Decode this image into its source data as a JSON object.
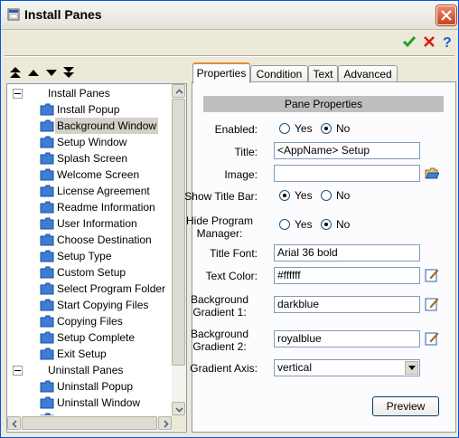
{
  "window": {
    "title": "Install Panes"
  },
  "toolbar": {
    "ok_icon": "check-icon",
    "cancel_icon": "x-icon",
    "help_icon": "question-icon"
  },
  "tree": {
    "items": [
      {
        "label": "Install Panes",
        "type": "group"
      },
      {
        "label": "Install Popup",
        "type": "folder"
      },
      {
        "label": "Background Window",
        "type": "folder",
        "selected": true
      },
      {
        "label": "Setup Window",
        "type": "folder"
      },
      {
        "label": "Splash Screen",
        "type": "folder"
      },
      {
        "label": "Welcome Screen",
        "type": "folder"
      },
      {
        "label": "License Agreement",
        "type": "folder"
      },
      {
        "label": "Readme Information",
        "type": "folder"
      },
      {
        "label": "User Information",
        "type": "folder"
      },
      {
        "label": "Choose Destination",
        "type": "folder"
      },
      {
        "label": "Setup Type",
        "type": "folder"
      },
      {
        "label": "Custom Setup",
        "type": "folder"
      },
      {
        "label": "Select Program Folder",
        "type": "folder"
      },
      {
        "label": "Start Copying Files",
        "type": "folder"
      },
      {
        "label": "Copying Files",
        "type": "folder"
      },
      {
        "label": "Setup Complete",
        "type": "folder"
      },
      {
        "label": "Exit Setup",
        "type": "folder"
      },
      {
        "label": "Uninstall Panes",
        "type": "group"
      },
      {
        "label": "Uninstall Popup",
        "type": "folder"
      },
      {
        "label": "Uninstall Window",
        "type": "folder"
      }
    ]
  },
  "tabs": [
    {
      "label": "Properties",
      "active": true
    },
    {
      "label": "Condition"
    },
    {
      "label": "Text"
    },
    {
      "label": "Advanced"
    }
  ],
  "panel": {
    "header": "Pane Properties",
    "enabled": {
      "label": "Enabled:",
      "yes": "Yes",
      "no": "No",
      "value": "No"
    },
    "title": {
      "label": "Title:",
      "value": "<AppName> Setup"
    },
    "image": {
      "label": "Image:",
      "value": ""
    },
    "show_title_bar": {
      "label": "Show Title Bar:",
      "yes": "Yes",
      "no": "No",
      "value": "Yes"
    },
    "hide_program_manager": {
      "label1": "Hide Program",
      "label2": "Manager:",
      "yes": "Yes",
      "no": "No",
      "value": "No"
    },
    "title_font": {
      "label": "Title Font:",
      "value": "Arial 36 bold"
    },
    "text_color": {
      "label": "Text Color:",
      "value": "#ffffff"
    },
    "bg_gradient1": {
      "label1": "Background",
      "label2": "Gradient 1:",
      "value": "darkblue"
    },
    "bg_gradient2": {
      "label1": "Background",
      "label2": "Gradient 2:",
      "value": "royalblue"
    },
    "gradient_axis": {
      "label": "Gradient Axis:",
      "value": "vertical"
    },
    "preview_label": "Preview"
  },
  "colors": {
    "accent": "#e68b2c",
    "folder": "#3d7dd6",
    "check": "#2a9d2a",
    "cancel": "#d0201a",
    "help": "#1f5bd6"
  }
}
